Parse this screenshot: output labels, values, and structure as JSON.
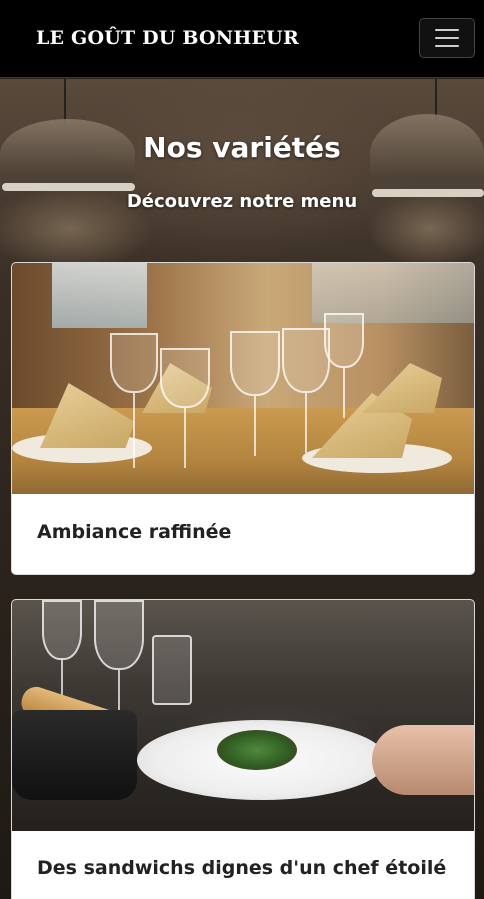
{
  "navbar": {
    "brand": "LE GOÛT DU BONHEUR",
    "toggle_icon": "hamburger-menu-icon"
  },
  "hero": {
    "title": "Nos variétés",
    "subtitle": "Découvrez notre menu"
  },
  "cards": [
    {
      "title": "Ambiance raffinée",
      "image": "dining-room-photo"
    },
    {
      "title": "Des sandwichs dignes d'un chef étoilé",
      "image": "plated-dish-photo"
    }
  ],
  "colors": {
    "navbar_bg": "#000000",
    "text_light": "#ffffff",
    "card_bg": "#ffffff",
    "card_text": "#222222"
  }
}
